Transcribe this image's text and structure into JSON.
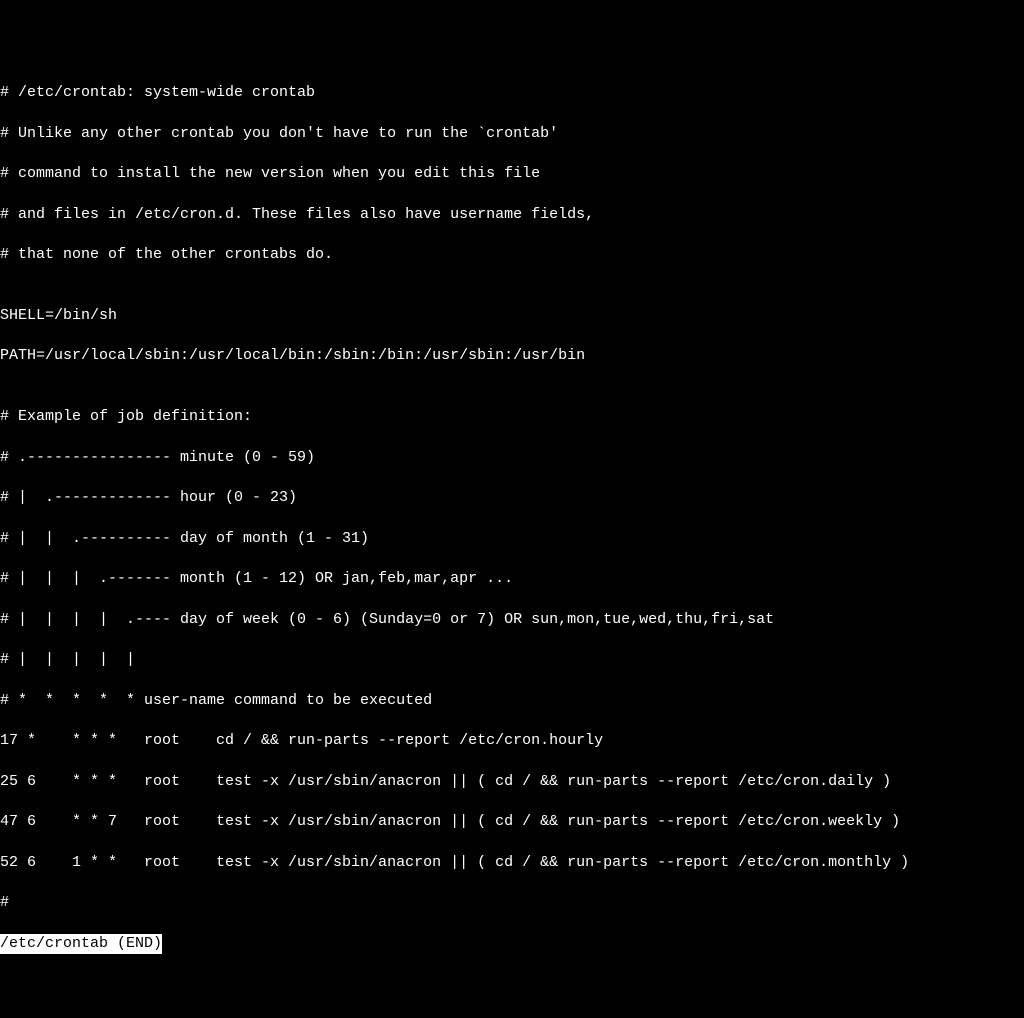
{
  "crontab": {
    "comment_lines": [
      "# /etc/crontab: system-wide crontab",
      "# Unlike any other crontab you don't have to run the `crontab'",
      "# command to install the new version when you edit this file",
      "# and files in /etc/cron.d. These files also have username fields,",
      "# that none of the other crontabs do."
    ],
    "blank1": "",
    "env_lines": [
      "SHELL=/bin/sh",
      "PATH=/usr/local/sbin:/usr/local/bin:/sbin:/bin:/usr/sbin:/usr/bin"
    ],
    "blank2": "",
    "definition_header": "# Example of job definition:",
    "def_lines": [
      "# .---------------- minute (0 - 59)",
      "# |  .------------- hour (0 - 23)",
      "# |  |  .---------- day of month (1 - 31)",
      "# |  |  |  .------- month (1 - 12) OR jan,feb,mar,apr ...",
      "# |  |  |  |  .---- day of week (0 - 6) (Sunday=0 or 7) OR sun,mon,tue,wed,thu,fri,sat",
      "# |  |  |  |  |",
      "# *  *  *  *  * user-name command to be executed"
    ],
    "job_lines": [
      "17 *    * * *   root    cd / && run-parts --report /etc/cron.hourly",
      "25 6    * * *   root    test -x /usr/sbin/anacron || ( cd / && run-parts --report /etc/cron.daily )",
      "47 6    * * 7   root    test -x /usr/sbin/anacron || ( cd / && run-parts --report /etc/cron.weekly )",
      "52 6    1 * *   root    test -x /usr/sbin/anacron || ( cd / && run-parts --report /etc/cron.monthly )"
    ],
    "trailing_hash": "#",
    "status_line": "/etc/crontab (END)"
  }
}
